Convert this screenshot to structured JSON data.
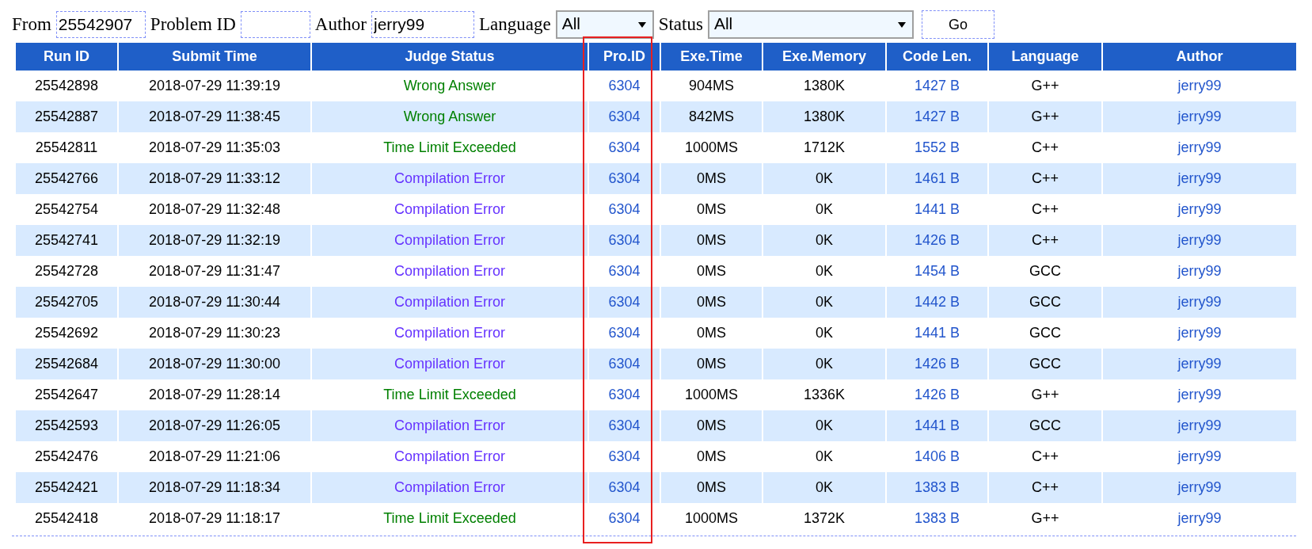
{
  "filter": {
    "from_label": "From",
    "from_value": "25542907",
    "problem_label": "Problem ID",
    "author_label": "Author",
    "author_value": "jerry99",
    "language_label": "Language",
    "language_value": "All",
    "status_label": "Status",
    "status_value": "All",
    "go_button": "Go"
  },
  "table": {
    "columns": [
      "Run ID",
      "Submit Time",
      "Judge Status",
      "Pro.ID",
      "Exe.Time",
      "Exe.Memory",
      "Code Len.",
      "Language",
      "Author"
    ],
    "rows": [
      {
        "run_id": "25542898",
        "time": "2018-07-29 11:39:19",
        "status": "Wrong Answer",
        "kind": "wa",
        "pro_id": "6304",
        "exe_time": "904MS",
        "memory": "1380K",
        "code_len": "1427 B",
        "language": "G++",
        "author": "jerry99"
      },
      {
        "run_id": "25542887",
        "time": "2018-07-29 11:38:45",
        "status": "Wrong Answer",
        "kind": "wa",
        "pro_id": "6304",
        "exe_time": "842MS",
        "memory": "1380K",
        "code_len": "1427 B",
        "language": "G++",
        "author": "jerry99"
      },
      {
        "run_id": "25542811",
        "time": "2018-07-29 11:35:03",
        "status": "Time Limit Exceeded",
        "kind": "tle",
        "pro_id": "6304",
        "exe_time": "1000MS",
        "memory": "1712K",
        "code_len": "1552 B",
        "language": "C++",
        "author": "jerry99"
      },
      {
        "run_id": "25542766",
        "time": "2018-07-29 11:33:12",
        "status": "Compilation Error",
        "kind": "ce",
        "pro_id": "6304",
        "exe_time": "0MS",
        "memory": "0K",
        "code_len": "1461 B",
        "language": "C++",
        "author": "jerry99"
      },
      {
        "run_id": "25542754",
        "time": "2018-07-29 11:32:48",
        "status": "Compilation Error",
        "kind": "ce",
        "pro_id": "6304",
        "exe_time": "0MS",
        "memory": "0K",
        "code_len": "1441 B",
        "language": "C++",
        "author": "jerry99"
      },
      {
        "run_id": "25542741",
        "time": "2018-07-29 11:32:19",
        "status": "Compilation Error",
        "kind": "ce",
        "pro_id": "6304",
        "exe_time": "0MS",
        "memory": "0K",
        "code_len": "1426 B",
        "language": "C++",
        "author": "jerry99"
      },
      {
        "run_id": "25542728",
        "time": "2018-07-29 11:31:47",
        "status": "Compilation Error",
        "kind": "ce",
        "pro_id": "6304",
        "exe_time": "0MS",
        "memory": "0K",
        "code_len": "1454 B",
        "language": "GCC",
        "author": "jerry99"
      },
      {
        "run_id": "25542705",
        "time": "2018-07-29 11:30:44",
        "status": "Compilation Error",
        "kind": "ce",
        "pro_id": "6304",
        "exe_time": "0MS",
        "memory": "0K",
        "code_len": "1442 B",
        "language": "GCC",
        "author": "jerry99"
      },
      {
        "run_id": "25542692",
        "time": "2018-07-29 11:30:23",
        "status": "Compilation Error",
        "kind": "ce",
        "pro_id": "6304",
        "exe_time": "0MS",
        "memory": "0K",
        "code_len": "1441 B",
        "language": "GCC",
        "author": "jerry99"
      },
      {
        "run_id": "25542684",
        "time": "2018-07-29 11:30:00",
        "status": "Compilation Error",
        "kind": "ce",
        "pro_id": "6304",
        "exe_time": "0MS",
        "memory": "0K",
        "code_len": "1426 B",
        "language": "GCC",
        "author": "jerry99"
      },
      {
        "run_id": "25542647",
        "time": "2018-07-29 11:28:14",
        "status": "Time Limit Exceeded",
        "kind": "tle",
        "pro_id": "6304",
        "exe_time": "1000MS",
        "memory": "1336K",
        "code_len": "1426 B",
        "language": "G++",
        "author": "jerry99"
      },
      {
        "run_id": "25542593",
        "time": "2018-07-29 11:26:05",
        "status": "Compilation Error",
        "kind": "ce",
        "pro_id": "6304",
        "exe_time": "0MS",
        "memory": "0K",
        "code_len": "1441 B",
        "language": "GCC",
        "author": "jerry99"
      },
      {
        "run_id": "25542476",
        "time": "2018-07-29 11:21:06",
        "status": "Compilation Error",
        "kind": "ce",
        "pro_id": "6304",
        "exe_time": "0MS",
        "memory": "0K",
        "code_len": "1406 B",
        "language": "C++",
        "author": "jerry99"
      },
      {
        "run_id": "25542421",
        "time": "2018-07-29 11:18:34",
        "status": "Compilation Error",
        "kind": "ce",
        "pro_id": "6304",
        "exe_time": "0MS",
        "memory": "0K",
        "code_len": "1383 B",
        "language": "C++",
        "author": "jerry99"
      },
      {
        "run_id": "25542418",
        "time": "2018-07-29 11:18:17",
        "status": "Time Limit Exceeded",
        "kind": "tle",
        "pro_id": "6304",
        "exe_time": "1000MS",
        "memory": "1372K",
        "code_len": "1383 B",
        "language": "G++",
        "author": "jerry99"
      }
    ]
  }
}
